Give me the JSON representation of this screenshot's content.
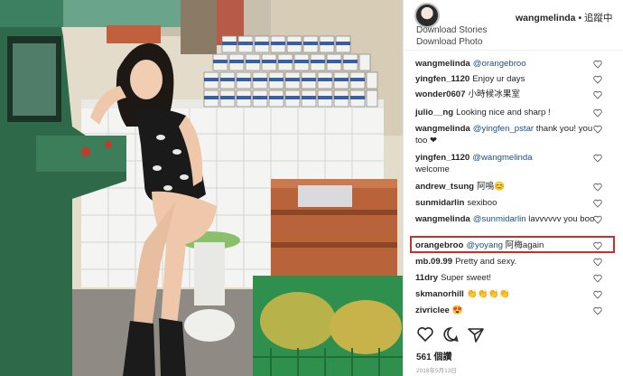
{
  "header": {
    "username": "wangmelinda",
    "follow_status": "• 追蹤中",
    "menu": [
      "Download Stories",
      "Download Photo"
    ]
  },
  "comments": [
    {
      "user": "wangmelinda",
      "mention": "@orangebroo",
      "text": ""
    },
    {
      "user": "yingfen_1120",
      "mention": "",
      "text": "Enjoy ur days"
    },
    {
      "user": "wonder0607",
      "mention": "",
      "text": "小時候冰果室"
    },
    {
      "user": "julio__ng",
      "mention": "",
      "text": "Looking nice and sharp !"
    },
    {
      "user": "wangmelinda",
      "mention": "@yingfen_pstar",
      "text": "thank you! you too ❤"
    },
    {
      "user": "yingfen_1120",
      "mention": "@wangmelinda",
      "text": "welcome"
    },
    {
      "user": "andrew_tsung",
      "mention": "",
      "text": "阿嗚😊"
    },
    {
      "user": "sunmidarlin",
      "mention": "",
      "text": "sexiboo"
    },
    {
      "user": "wangmelinda",
      "mention": "@sunmidarlin",
      "text": "lavvvvvv you boo"
    },
    {
      "user": "orangebroo",
      "mention": "@yoyang",
      "text": "阿梅again"
    },
    {
      "user": "mb.09.99",
      "mention": "",
      "text": "Pretty and sexy."
    },
    {
      "user": "11dry",
      "mention": "",
      "text": "Super sweet!"
    },
    {
      "user": "skmanorhill",
      "mention": "",
      "text": "👏👏👏👏"
    },
    {
      "user": "zivriclee",
      "mention": "",
      "text": "😍"
    }
  ],
  "footer": {
    "likes": "561 個讚",
    "date": "2018年5月13日"
  },
  "icons": {
    "comment_heart": "heart-outline-icon",
    "like": "heart-icon",
    "comment": "comment-icon",
    "share": "share-icon"
  },
  "colors": {
    "highlight_border": "#c9302c",
    "mention": "#1c4f80"
  }
}
